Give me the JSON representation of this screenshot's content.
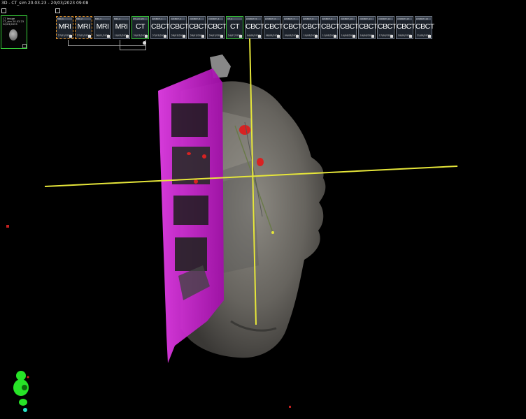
{
  "window": {
    "title": "3D - CT_sim 20.03.23 - 20/03/2023 09:08"
  },
  "thumbnail": {
    "line1": "CT Image",
    "line2": "CT_sim 20.03.23",
    "line3": "20/03/2023"
  },
  "series": [
    {
      "header": "MRI_1",
      "modality": "MRI",
      "date": "27/03/2022",
      "style": "mri-sel"
    },
    {
      "header": "MRI_2",
      "modality": "MRI",
      "date": "27/03/2022",
      "style": "mri-sel"
    },
    {
      "header": "MRI_3",
      "modality": "MRI",
      "date": "26/01/2023",
      "style": "grey"
    },
    {
      "header": "MRI_4",
      "modality": "MRI",
      "date": "10/03/2023",
      "style": "grey"
    },
    {
      "header": "CT_sim 20",
      "modality": "CT",
      "date": "20/03/2023",
      "style": "ct-active"
    },
    {
      "header": "kVCBCT_1",
      "modality": "CBCT",
      "date": "27/03/2023",
      "style": "grey"
    },
    {
      "header": "kVCBCT_2",
      "modality": "CBCT",
      "date": "28/03/2023",
      "style": "grey"
    },
    {
      "header": "kVCBCT_3",
      "modality": "CBCT",
      "date": "28/03/2023",
      "style": "grey"
    },
    {
      "header": "kVCBCT_4",
      "modality": "CBCT",
      "date": "29/03/2023",
      "style": "grey"
    },
    {
      "header": "CT_2",
      "modality": "CT",
      "date": "24/07/2023",
      "style": "ct-active"
    },
    {
      "header": "kVCBCT_5",
      "modality": "CBCT",
      "date": "04/08/2023",
      "style": "grey"
    },
    {
      "header": "kVCBCT_6",
      "modality": "CBCT",
      "date": "08/08/2023",
      "style": "grey"
    },
    {
      "header": "kVCBCT_7",
      "modality": "CBCT",
      "date": "09/08/2023",
      "style": "grey"
    },
    {
      "header": "kVCBCT_8",
      "modality": "CBCT",
      "date": "10/08/2023",
      "style": "grey"
    },
    {
      "header": "kVCBCT_9",
      "modality": "CBCT",
      "date": "11/08/2023",
      "style": "grey"
    },
    {
      "header": "kVCBCT_10",
      "modality": "CBCT",
      "date": "14/08/2023",
      "style": "grey"
    },
    {
      "header": "kVCBCT_11",
      "modality": "CBCT",
      "date": "16/08/2023",
      "style": "grey"
    },
    {
      "header": "kVCBCT_12",
      "modality": "CBCT",
      "date": "17/08/2023",
      "style": "grey"
    },
    {
      "header": "kVCBCT_13",
      "modality": "CBCT",
      "date": "18/08/2023",
      "style": "grey"
    },
    {
      "header": "kVCBCT_14",
      "modality": "CBCT",
      "date": "21/08/2023",
      "style": "grey"
    }
  ],
  "colors": {
    "background": "#000000",
    "crosshair": "#e6e63a",
    "immobilization_mask": "#d21ad8",
    "anatomy_surface": "#8a8780",
    "marker": "#d82222",
    "ct_active_border": "#37c43a",
    "mri_selected_border": "#e7962b",
    "orientation_widget": "#27e327"
  },
  "icons": {
    "corner_flag": "checkbox-flag-icon",
    "orientation": "orientation-figure-icon"
  }
}
